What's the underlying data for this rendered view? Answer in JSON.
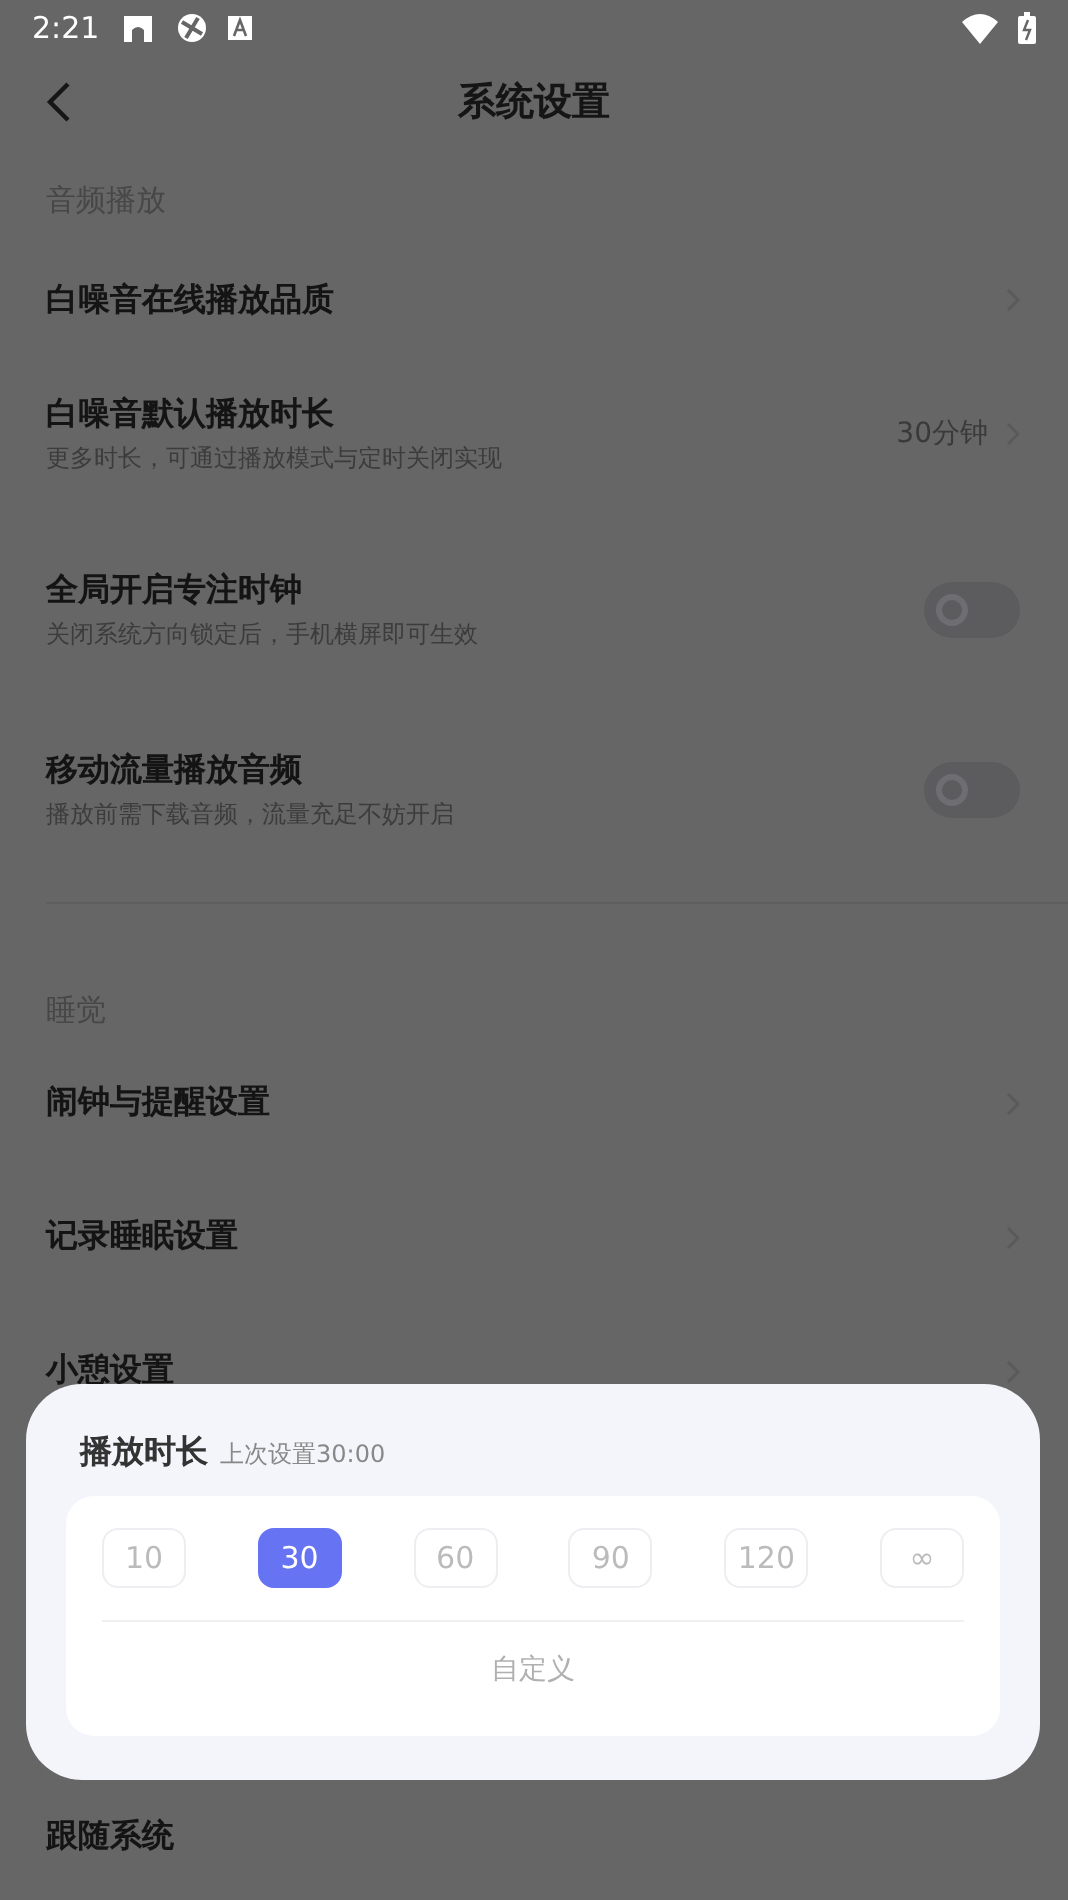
{
  "status_bar": {
    "time": "2:21"
  },
  "header": {
    "title": "系统设置"
  },
  "sections": [
    {
      "label": "音频播放",
      "rows": [
        {
          "kind": "link",
          "title": "白噪音在线播放品质"
        },
        {
          "kind": "link",
          "title": "白噪音默认播放时长",
          "subtitle": "更多时长，可通过播放模式与定时关闭实现",
          "value": "30分钟"
        },
        {
          "kind": "toggle",
          "title": "全局开启专注时钟",
          "subtitle": "关闭系统方向锁定后，手机横屏即可生效",
          "on": false
        },
        {
          "kind": "toggle",
          "title": "移动流量播放音频",
          "subtitle": "播放前需下载音频，流量充足不妨开启",
          "on": false
        }
      ]
    },
    {
      "label": "睡觉",
      "rows": [
        {
          "kind": "link",
          "title": "闹钟与提醒设置"
        },
        {
          "kind": "link",
          "title": "记录睡眠设置"
        },
        {
          "kind": "link",
          "title": "小憩设置"
        }
      ]
    }
  ],
  "bottom_row": {
    "title": "跟随系统"
  },
  "sheet": {
    "title": "播放时长",
    "hint": "上次设置30:00",
    "options": [
      {
        "label": "10",
        "selected": false
      },
      {
        "label": "30",
        "selected": true
      },
      {
        "label": "60",
        "selected": false
      },
      {
        "label": "90",
        "selected": false
      },
      {
        "label": "120",
        "selected": false
      },
      {
        "label": "∞",
        "selected": false
      }
    ],
    "custom": "自定义"
  }
}
